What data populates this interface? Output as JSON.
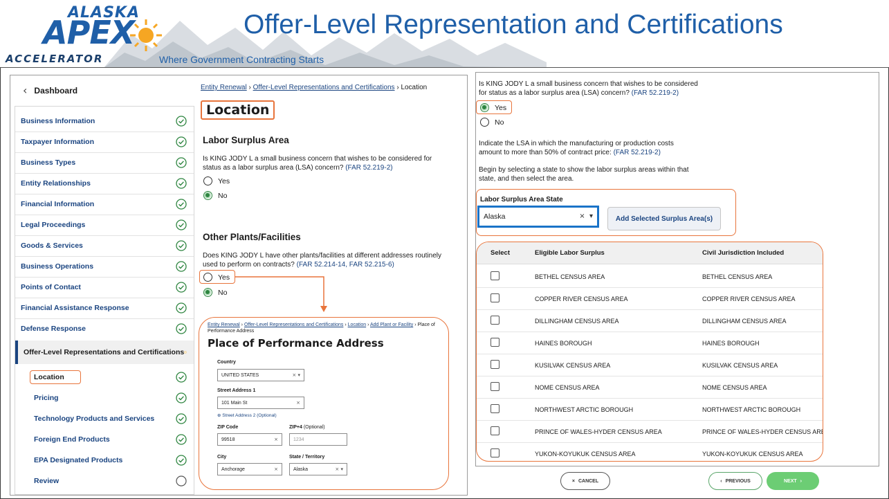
{
  "header": {
    "logo_top": "ALASKA",
    "logo_main": "APEX",
    "logo_bottom": "ACCELERATOR",
    "tagline": "Where Government Contracting Starts",
    "title": "Offer-Level Representation and Certifications"
  },
  "left": {
    "dashboard_label": "Dashboard",
    "sidebar": {
      "items": [
        {
          "label": "Business Information",
          "status": "complete"
        },
        {
          "label": "Taxpayer Information",
          "status": "complete"
        },
        {
          "label": "Business Types",
          "status": "complete"
        },
        {
          "label": "Entity Relationships",
          "status": "complete"
        },
        {
          "label": "Financial Information",
          "status": "complete"
        },
        {
          "label": "Legal Proceedings",
          "status": "complete"
        },
        {
          "label": "Goods & Services",
          "status": "complete"
        },
        {
          "label": "Business Operations",
          "status": "complete"
        },
        {
          "label": "Points of Contact",
          "status": "complete"
        },
        {
          "label": "Financial Assistance Response",
          "status": "complete"
        },
        {
          "label": "Defense Response",
          "status": "complete"
        },
        {
          "label": "Offer-Level Representations and Certifications",
          "status": "in-progress"
        },
        {
          "label": "Location",
          "status": "complete"
        },
        {
          "label": "Pricing",
          "status": "complete"
        },
        {
          "label": "Technology Products and Services",
          "status": "complete"
        },
        {
          "label": "Foreign End Products",
          "status": "complete"
        },
        {
          "label": "EPA Designated Products",
          "status": "complete"
        },
        {
          "label": "Review",
          "status": "not-started"
        }
      ]
    },
    "breadcrumb": {
      "c1": "Entity Renewal",
      "sep": "›",
      "c2": "Offer-Level Representations and Certifications",
      "c3": "Location"
    },
    "page_title": "Location",
    "lsa": {
      "title": "Labor Surplus Area",
      "question": "Is KING JODY L a small business concern that wishes to be considered for status as a labor surplus area (LSA) concern?",
      "far": "(FAR 52.219-2)",
      "yes": "Yes",
      "no": "No"
    },
    "plants": {
      "title": "Other Plants/Facilities",
      "question": "Does KING JODY L have other plants/facilities at different addresses routinely used to perform on contracts?",
      "far1": "(FAR 52.214-14,",
      "far2": "FAR 52.215-6)",
      "yes": "Yes",
      "no": "No"
    },
    "pop": {
      "crumb1": "Entity Renewal",
      "crumb2": "Offer-Level Representations and Certifications",
      "crumb3": "Location",
      "crumb4": "Add Plant or Facility",
      "crumb5": "Place of Performance Address",
      "sep": "›",
      "title": "Place of Performance Address",
      "country_label": "Country",
      "country_value": "UNITED STATES",
      "street1_label": "Street Address 1",
      "street1_value": "101 Main St",
      "street2_link": "Street Address 2 (Optional)",
      "zip_label": "ZIP Code",
      "zip_value": "99518",
      "zip4_label": "ZIP+4",
      "zip4_optional": "(Optional)",
      "zip4_placeholder": "1234",
      "city_label": "City",
      "city_value": "Anchorage",
      "state_label": "State / Territory",
      "state_value": "Alaska"
    }
  },
  "right": {
    "question": "Is KING JODY L a small business concern that wishes to be considered for status as a labor surplus area (LSA) concern?",
    "far": "(FAR 52.219-2)",
    "yes": "Yes",
    "no": "No",
    "indicate": "Indicate the LSA in which the manufacturing or production costs amount to more than 50% of contract price:",
    "indicate_far": "(FAR 52.219-2)",
    "begin": "Begin by selecting a state to show the labor surplus areas within that state, and then select the area.",
    "state_label": "Labor Surplus Area State",
    "state_value": "Alaska",
    "add_button": "Add Selected Surplus Area(s)",
    "table": {
      "headers": [
        "Select",
        "Eligible Labor Surplus",
        "Civil Jurisdiction Included"
      ],
      "rows": [
        {
          "area": "BETHEL CENSUS AREA",
          "jurisdiction": "BETHEL CENSUS AREA"
        },
        {
          "area": "COPPER RIVER CENSUS AREA",
          "jurisdiction": "COPPER RIVER CENSUS AREA"
        },
        {
          "area": "DILLINGHAM CENSUS AREA",
          "jurisdiction": "DILLINGHAM CENSUS AREA"
        },
        {
          "area": "HAINES BOROUGH",
          "jurisdiction": "HAINES BOROUGH"
        },
        {
          "area": "KUSILVAK CENSUS AREA",
          "jurisdiction": "KUSILVAK CENSUS AREA"
        },
        {
          "area": "NOME CENSUS AREA",
          "jurisdiction": "NOME CENSUS AREA"
        },
        {
          "area": "NORTHWEST ARCTIC BOROUGH",
          "jurisdiction": "NORTHWEST ARCTIC BOROUGH"
        },
        {
          "area": "PRINCE OF WALES-HYDER CENSUS AREA",
          "jurisdiction": "PRINCE OF WALES-HYDER CENSUS AREA"
        },
        {
          "area": "YUKON-KOYUKUK CENSUS AREA",
          "jurisdiction": "YUKON-KOYUKUK CENSUS AREA"
        }
      ]
    }
  },
  "buttons": {
    "cancel": "CANCEL",
    "previous": "PREVIOUS",
    "next": "NEXT"
  },
  "colors": {
    "title_blue": "#1f5fa8",
    "link_blue": "#1a4480",
    "highlight_orange": "#e8743b",
    "success_green": "#2e8540",
    "next_green": "#6ccd74"
  }
}
